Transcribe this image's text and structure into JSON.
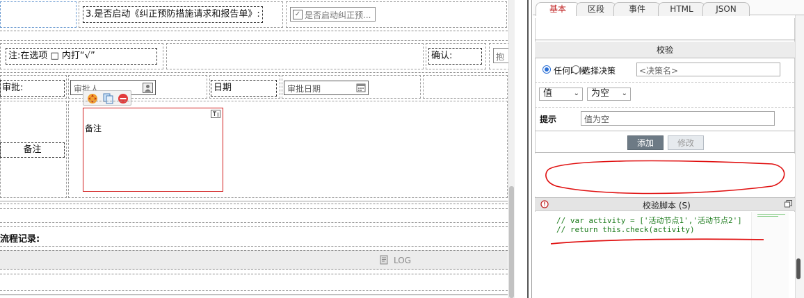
{
  "form": {
    "q3_label": "3.是否启动《纠正预防措施请求和报告单》:",
    "q3_checkbox_label": "是否启动纠正预...",
    "note_label": "注:在选项 □ 内打“√”",
    "confirm_label": "确认:",
    "hold_partial": "抱",
    "approve_label": "审批:",
    "approver_placeholder": "审批人",
    "date_label": "日期",
    "approve_date_placeholder": "审批日期",
    "remark_label": "备注",
    "remark_text": "备注",
    "flow_label": "流程记录:",
    "log_label": "LOG"
  },
  "panel": {
    "tabs": [
      "基本",
      "区段",
      "事件",
      "HTML",
      "JSON"
    ],
    "active_tab": "基本",
    "section_title": "校验",
    "radio_anytime": "任何时候",
    "radio_choose": "选择决策",
    "decision_placeholder": "<决策名>",
    "value_select": "值",
    "condition_select": "为空",
    "hint_label": "提示",
    "hint_value": "值为空",
    "add_button": "添加",
    "modify_button": "修改",
    "script_title": "校验脚本 (S)",
    "code_line1": "// var activity = ['活动节点1','活动节点2']",
    "code_line2": "// return this.check(activity)"
  },
  "colors": {
    "annotation_red": "#e01010",
    "button_dark": "#6d7a85",
    "remark_border": "#d01a1a"
  }
}
